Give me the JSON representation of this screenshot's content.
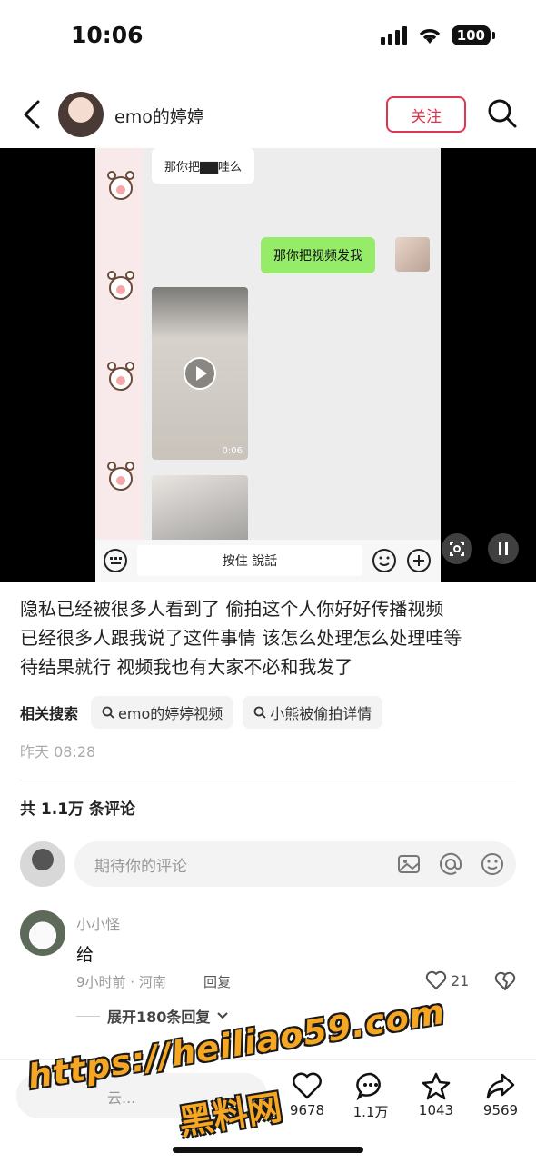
{
  "status_bar": {
    "time": "10:06",
    "battery": "100"
  },
  "header": {
    "author": "emo的婷婷",
    "follow_label": "关注"
  },
  "video": {
    "chat_in": "那你把▇▇哇么",
    "chat_out": "那你把视频发我",
    "video_duration": "0:06",
    "hold_to_talk": "按住 說話"
  },
  "caption": {
    "lines": [
      "隐私已经被很多人看到了 偷拍这个人你好好传播视频",
      "已经很多人跟我说了这件事情 该怎么处理怎么处理哇等",
      "待结果就行 视频我也有大家不必和我发了"
    ]
  },
  "related": {
    "label": "相关搜索",
    "chips": [
      "emo的婷婷视频",
      "小熊被偷拍详情"
    ]
  },
  "post_time": "昨天 08:28",
  "comments": {
    "count_label": "共 1.1万 条评论",
    "placeholder": "期待你的评论",
    "items": [
      {
        "user": "小小怪",
        "text": "给",
        "meta": "9小时前 · 河南",
        "reply_label": "回复",
        "likes": "21",
        "expand_label": "展开180条回复"
      }
    ]
  },
  "bottom_bar": {
    "input_text": "云...",
    "likes": "9678",
    "comments": "1.1万",
    "favorites": "1043",
    "shares": "9569"
  },
  "watermark": {
    "url": "https://heiliao59.com",
    "name": "黑料网"
  },
  "colors": {
    "accent": "#e0354f",
    "bubble_green": "#95ec69",
    "watermark": "#f5a623"
  }
}
